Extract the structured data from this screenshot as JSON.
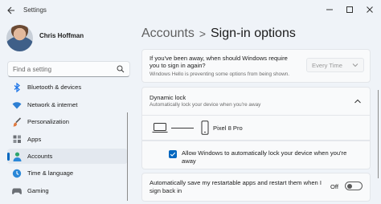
{
  "window": {
    "title": "Settings",
    "controls": [
      "minimize",
      "maximize",
      "close"
    ]
  },
  "profile": {
    "name": "Chris Hoffman"
  },
  "search": {
    "placeholder": "Find a setting"
  },
  "sidebar": {
    "items": [
      {
        "label": "Bluetooth & devices",
        "icon": "bluetooth-icon",
        "color": "#1a73e8"
      },
      {
        "label": "Network & internet",
        "icon": "wifi-icon",
        "color": "#2d7fd3"
      },
      {
        "label": "Personalization",
        "icon": "paintbrush-icon",
        "color": "#e07a3f"
      },
      {
        "label": "Apps",
        "icon": "apps-icon",
        "color": "#6b6f75"
      },
      {
        "label": "Accounts",
        "icon": "person-icon",
        "color": "#2fa56f",
        "active": true
      },
      {
        "label": "Time & language",
        "icon": "globe-clock-icon",
        "color": "#2b88d8"
      },
      {
        "label": "Gaming",
        "icon": "gamepad-icon",
        "color": "#6b6f75"
      }
    ]
  },
  "breadcrumb": {
    "parent": "Accounts",
    "separator": ">",
    "current": "Sign-in options"
  },
  "away_setting": {
    "title": "If you've been away, when should Windows require you to sign in again?",
    "subtitle": "Windows Hello is preventing some options from being shown.",
    "select_value": "Every Time"
  },
  "dynamic_lock": {
    "title": "Dynamic lock",
    "subtitle": "Automatically lock your device when you're away",
    "device_name": "Pixel 8 Pro",
    "checkbox_label": "Allow Windows to automatically lock your device when you're away",
    "checkbox_checked": true
  },
  "restart_apps": {
    "label": "Automatically save my restartable apps and restart them when I sign back in",
    "toggle_label": "Off",
    "toggle_on": false
  },
  "colors": {
    "accent": "#0067c0",
    "background": "#eff3f8",
    "card": "#f9fafb"
  }
}
